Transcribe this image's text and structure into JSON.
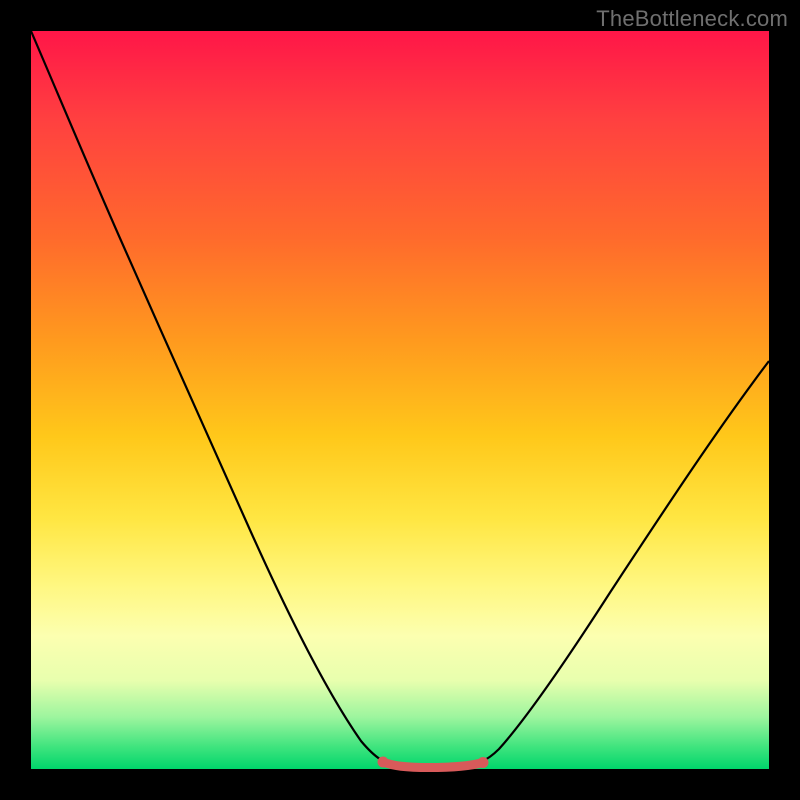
{
  "watermark": "TheBottleneck.com",
  "colors": {
    "frame": "#000000",
    "curve": "#000000",
    "highlight": "#d85a5a",
    "gradient_top": "#ff1648",
    "gradient_bottom": "#00d66b"
  },
  "chart_data": {
    "type": "line",
    "title": "",
    "xlabel": "",
    "ylabel": "",
    "xlim": [
      0,
      100
    ],
    "ylim": [
      0,
      100
    ],
    "series": [
      {
        "name": "curve",
        "x": [
          0,
          5,
          10,
          15,
          20,
          25,
          30,
          35,
          40,
          45,
          48,
          50,
          52,
          55,
          58,
          60,
          62,
          65,
          70,
          75,
          80,
          85,
          90,
          95,
          100
        ],
        "y": [
          100,
          89,
          78,
          67,
          56,
          45,
          34,
          23,
          13,
          5,
          1.5,
          0.6,
          0.3,
          0.2,
          0.3,
          0.6,
          1.3,
          3,
          8,
          15,
          23,
          31,
          39,
          47,
          55
        ]
      }
    ],
    "highlight": {
      "name": "bottom-segment",
      "x_range": [
        48,
        62
      ],
      "y": 0.4
    }
  }
}
